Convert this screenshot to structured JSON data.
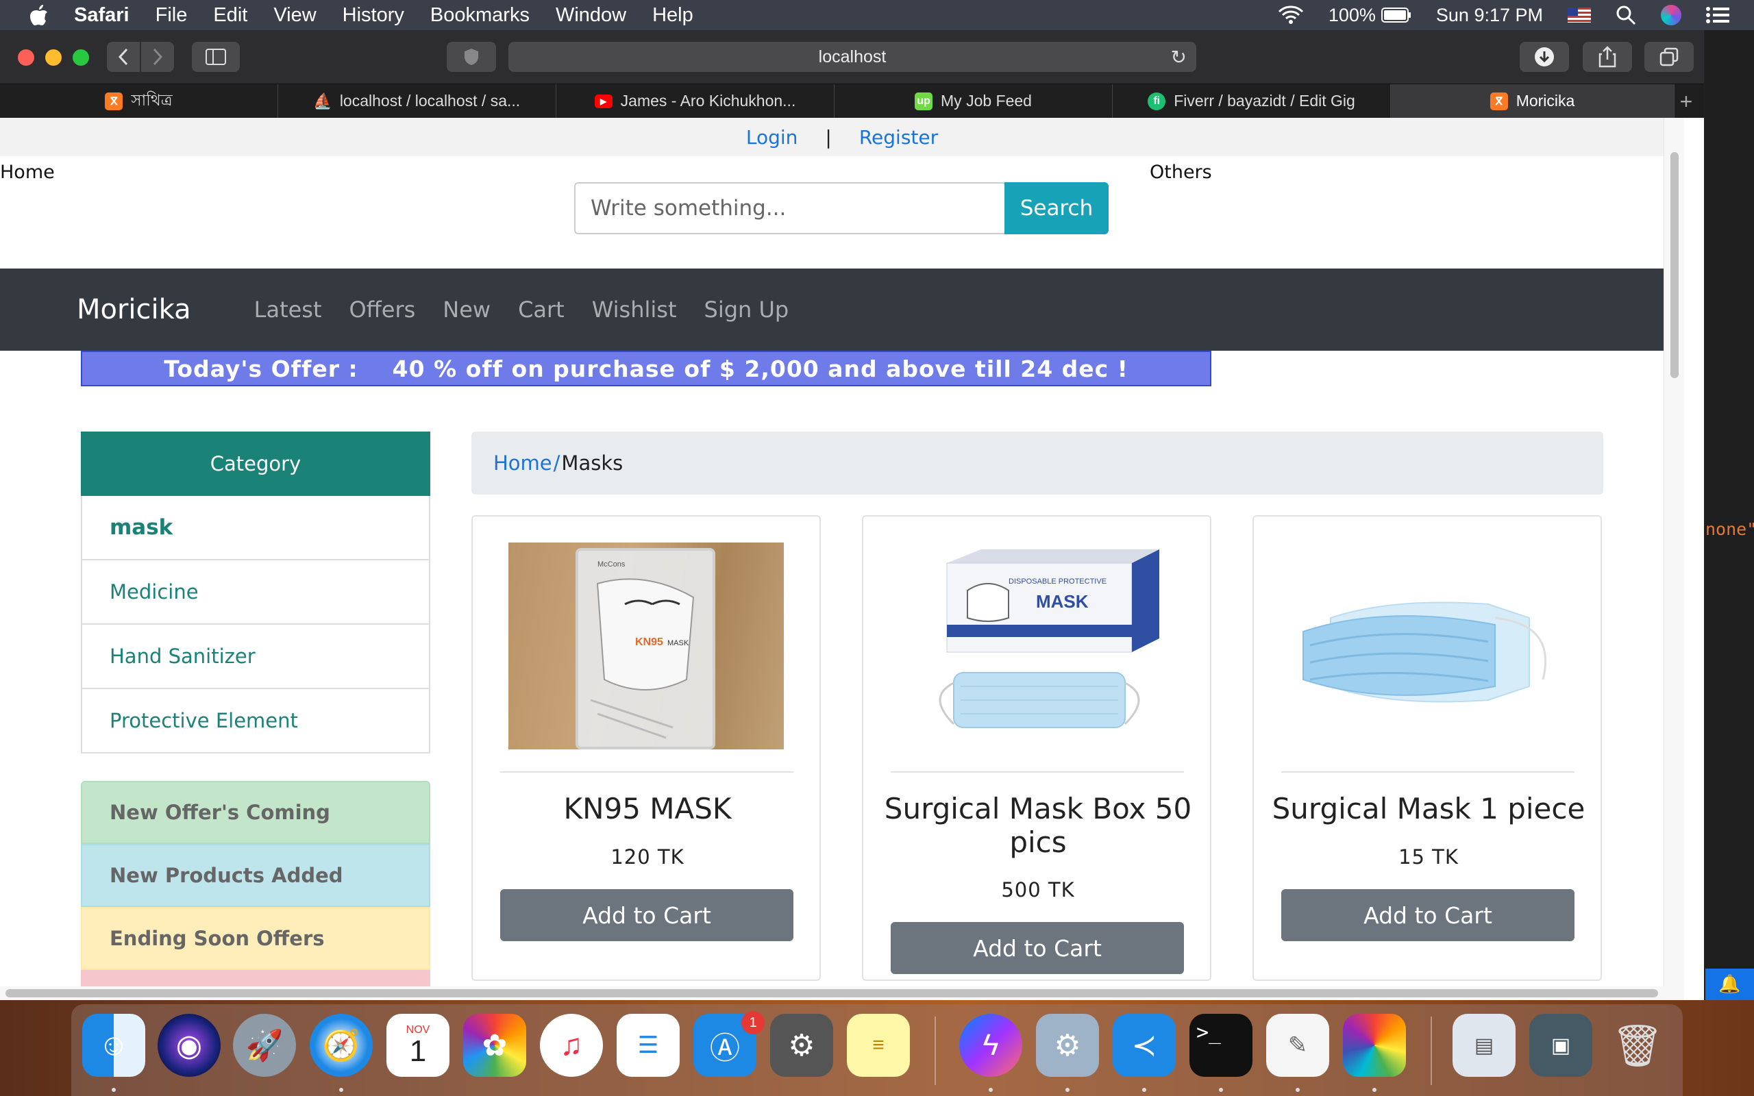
{
  "menubar": {
    "app_name": "Safari",
    "items": [
      "File",
      "Edit",
      "View",
      "History",
      "Bookmarks",
      "Window",
      "Help"
    ],
    "battery": "100%",
    "clock": "Sun 9:17 PM"
  },
  "browser": {
    "url": "localhost",
    "tabs": [
      {
        "label": "সাথিত্র",
        "favicon": "xampp-icon",
        "color": "#fb7a24"
      },
      {
        "label": "localhost / localhost / sa...",
        "favicon": "phpmyadmin-icon",
        "color": "#f4a11b"
      },
      {
        "label": "James - Aro Kichukhon...",
        "favicon": "youtube-icon",
        "color": "#ff0000"
      },
      {
        "label": "My Job Feed",
        "favicon": "upwork-icon",
        "color": "#6fda44"
      },
      {
        "label": "Fiverr / bayazidt / Edit Gig",
        "favicon": "fiverr-icon",
        "color": "#1dbf73"
      },
      {
        "label": "Moricika",
        "favicon": "xampp-icon",
        "color": "#fb7a24"
      }
    ]
  },
  "page": {
    "auth": {
      "login": "Login",
      "separator": "|",
      "register": "Register"
    },
    "top_nav": {
      "home": "Home",
      "others": "Others"
    },
    "search": {
      "placeholder": "Write something...",
      "button": "Search"
    },
    "navbar": {
      "brand": "Moricika",
      "links": [
        "Latest",
        "Offers",
        "New",
        "Cart",
        "Wishlist",
        "Sign Up"
      ]
    },
    "offer_text": "Today's Offer :    40 % off on purchase of $ 2,000 and above till 24 dec !",
    "sidebar": {
      "heading": "Category",
      "categories": [
        "mask",
        "Medicine",
        "Hand Sanitizer",
        "Protective Element"
      ],
      "notices": [
        {
          "label": "New Offer's Coming",
          "color": "#c3e6cb"
        },
        {
          "label": "New Products Added",
          "color": "#bee5eb"
        },
        {
          "label": "Ending Soon Offers",
          "color": "#ffeeba"
        }
      ]
    },
    "breadcrumb": {
      "home": "Home",
      "separator": "/",
      "current": "Masks"
    },
    "products": [
      {
        "name": "KN95 MASK",
        "price": "120 TK",
        "button": "Add to Cart"
      },
      {
        "name": "Surgical Mask Box 50 pics",
        "price": "500 TK",
        "button": "Add to Cart"
      },
      {
        "name": "Surgical Mask 1 piece",
        "price": "15 TK",
        "button": "Add to Cart"
      }
    ]
  },
  "behind_window_text": "none\"",
  "dock": {
    "calendar_month": "NOV",
    "calendar_day": "1",
    "appstore_badge": "1"
  },
  "colors": {
    "navbar": "#343a40",
    "category_header": "#1b8277",
    "search_button": "#17a2b8",
    "offer_banner": "#6e7be8",
    "add_to_cart": "#6c757d"
  }
}
